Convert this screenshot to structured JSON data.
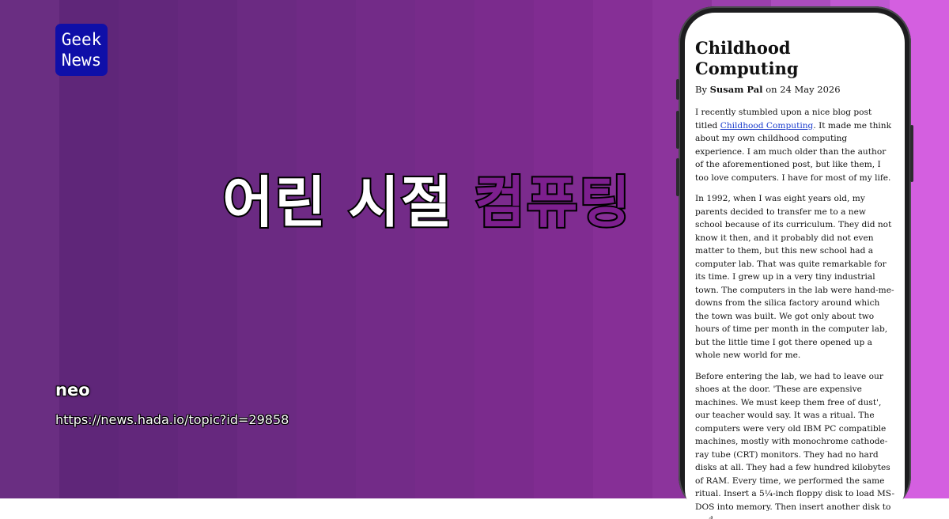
{
  "brand": {
    "line1": "Geek",
    "line2": "News"
  },
  "headline": {
    "white_part": "어린 시절",
    "accent_part": "컴퓨팅"
  },
  "author": "neo",
  "url": "https://news.hada.io/topic?id=29858",
  "colors": {
    "logo_bg": "#0f0fa8",
    "accent": "#7d1f8e",
    "link": "#1a3bcc"
  },
  "article": {
    "title": "Childhood Computing",
    "by": "By",
    "author": "Susam Pal",
    "date_prefix": "on",
    "date": "24 May 2026",
    "p1_before": "I recently stumbled upon a nice blog post titled ",
    "p1_link": "Childhood Computing",
    "p1_after": ". It made me think about my own childhood computing experience. I am much older than the author of the aforementioned post, but like them, I too love computers. I have for most of my life.",
    "p2": "In 1992, when I was eight years old, my parents decided to transfer me to a new school because of its curriculum. They did not know it then, and it probably did not even matter to them, but this new school had a computer lab. That was quite remarkable for its time. I grew up in a very tiny industrial town. The computers in the lab were hand-me-downs from the silica factory around which the town was built. We got only about two hours of time per month in the computer lab, but the little time I got there opened up a whole new world for me.",
    "p3": "Before entering the lab, we had to leave our shoes at the door. 'These are expensive machines. We must keep them free of dust', our teacher would say. It was a ritual. The computers were very old IBM PC compatible machines, mostly with monochrome cathode-ray tube (CRT) monitors. They had no hard disks at all. They had a few hundred kilobytes of RAM. Every time, we performed the same ritual. Insert a 5¼-inch floppy disk to load MS-DOS into memory. Then insert another disk to load"
  }
}
